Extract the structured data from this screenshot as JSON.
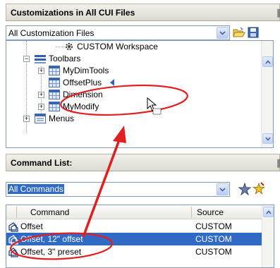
{
  "top_panel": {
    "title": "Customizations in All CUI Files",
    "collapse_icon": "double-chevron-icon",
    "file_combo_value": "All Customization Files",
    "tree": {
      "workspace": "CUSTOM Workspace",
      "toolbars": "Toolbars",
      "toolbar_items": [
        "MyDimTools",
        "OffsetPlus",
        "Dimension",
        "MyModify"
      ],
      "menus": "Menus"
    }
  },
  "bottom_panel": {
    "title": "Command List:",
    "filter_combo_value": "All Commands",
    "columns": [
      "Command",
      "Source"
    ],
    "rows": [
      {
        "command": "Offset",
        "source": "CUSTOM"
      },
      {
        "command": "Offset, 12\" offset",
        "source": "CUSTOM",
        "selected": true
      },
      {
        "command": "Offset, 3\" preset",
        "source": "CUSTOM"
      }
    ]
  },
  "colors": {
    "selection": "#316ac5",
    "annotation_red": "#e02020",
    "header_bg": "#e8e6dc"
  }
}
